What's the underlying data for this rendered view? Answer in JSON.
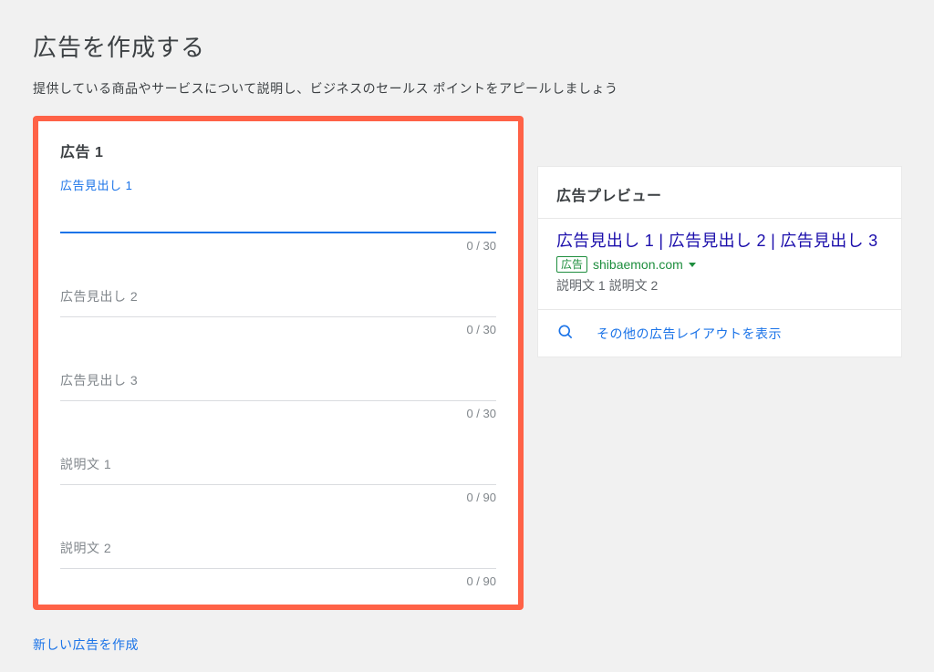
{
  "page": {
    "title": "広告を作成する",
    "subtitle": "提供している商品やサービスについて説明し、ビジネスのセールス ポイントをアピールしましょう"
  },
  "ad_card": {
    "title": "広告 1",
    "fields": {
      "headline1": {
        "label": "広告見出し 1",
        "counter": "0 / 30"
      },
      "headline2": {
        "label": "広告見出し 2",
        "counter": "0 / 30"
      },
      "headline3": {
        "label": "広告見出し 3",
        "counter": "0 / 30"
      },
      "desc1": {
        "label": "説明文 1",
        "counter": "0 / 90"
      },
      "desc2": {
        "label": "説明文 2",
        "counter": "0 / 90"
      }
    }
  },
  "new_ad_link": "新しい広告を作成",
  "preview": {
    "title": "広告プレビュー",
    "headline": "広告見出し 1 | 広告見出し 2 | 広告見出し 3",
    "ad_badge": "広告",
    "url": "shibaemon.com",
    "description": "説明文 1 説明文 2",
    "other_layouts": "その他の広告レイアウトを表示"
  }
}
